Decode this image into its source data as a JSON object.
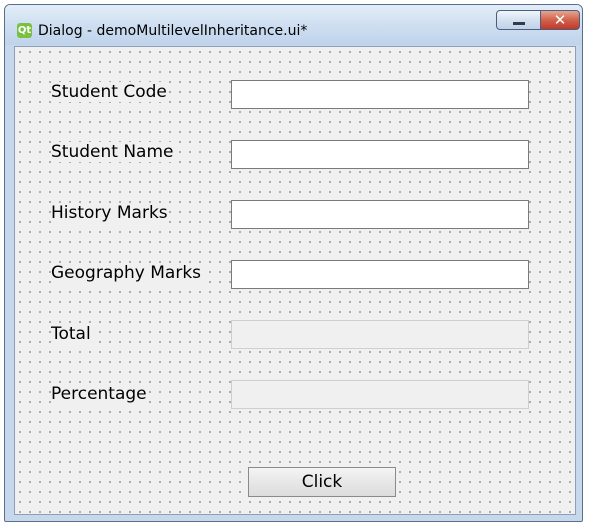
{
  "window": {
    "title": "Dialog - demoMultilevelInheritance.ui*",
    "app_icon_glyph": "Qt",
    "minimize_glyph": "",
    "close_glyph": "✕"
  },
  "form": {
    "student_code": {
      "label": "Student Code",
      "value": ""
    },
    "student_name": {
      "label": "Student Name",
      "value": ""
    },
    "history_marks": {
      "label": "History Marks",
      "value": ""
    },
    "geography_marks": {
      "label": "Geography Marks",
      "value": ""
    },
    "total": {
      "label": "Total",
      "value": ""
    },
    "percentage": {
      "label": "Percentage",
      "value": ""
    }
  },
  "buttons": {
    "click_label": "Click"
  },
  "icons": {
    "app": "qt-logo-icon",
    "minimize": "minimize-icon",
    "close": "close-icon"
  },
  "colors": {
    "title_bar": "#cfdff1",
    "close_button": "#c0392b",
    "canvas": "#f0f0f0",
    "grid_dots": "#9a9a9a"
  }
}
